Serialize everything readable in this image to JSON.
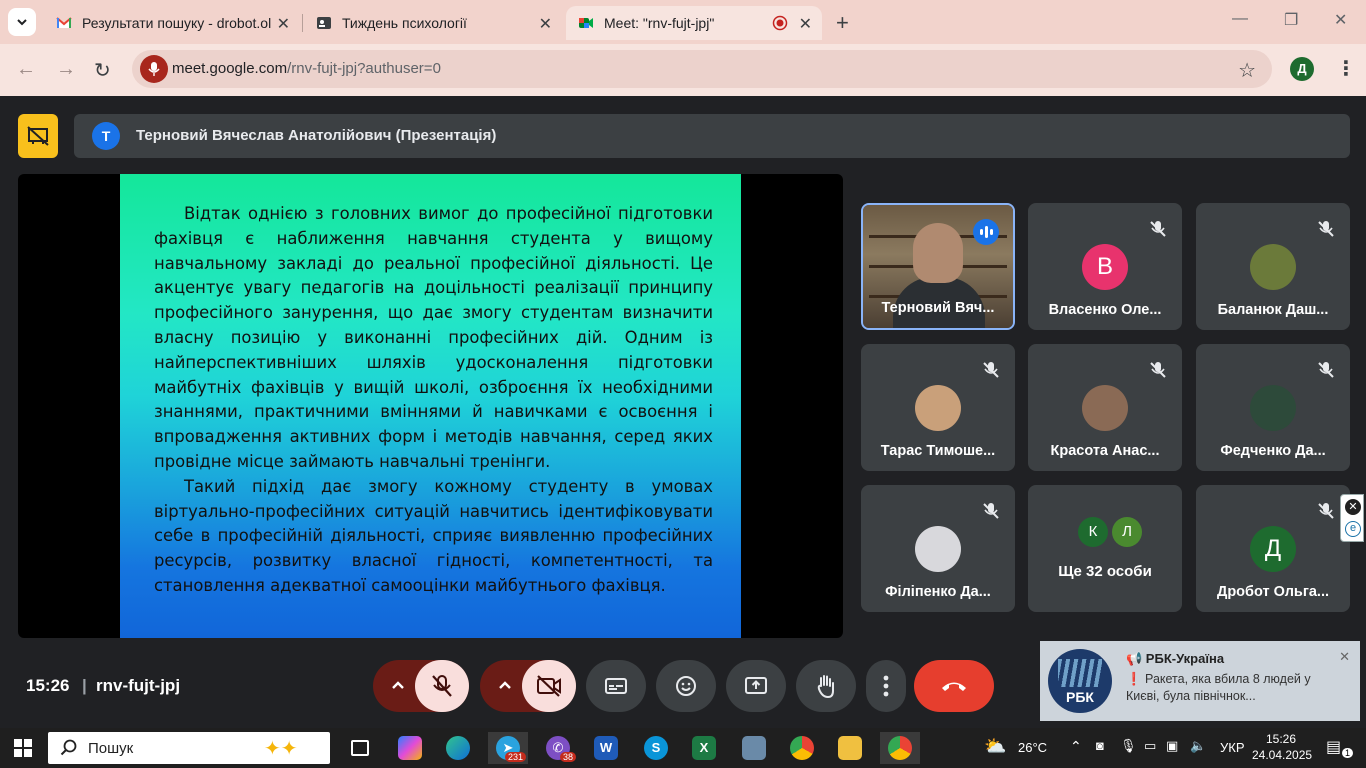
{
  "browser": {
    "tabs": [
      {
        "title": "Результати пошуку - drobot.ol",
        "active": false
      },
      {
        "title": "Тиждень психології",
        "active": false
      },
      {
        "title": "Meet: \"rnv-fujt-jpj\"",
        "active": true
      }
    ],
    "url_host": "meet.google.com",
    "url_path": "/rnv-fujt-jpj?authuser=0",
    "profile_initial": "Д"
  },
  "meet": {
    "presenter_initial": "T",
    "presenter_label": "Терновий Вячеслав Анатолійович (Презентація)",
    "slide_paragraphs": [
      "Відтак однією з головних вимог до професійної підготовки фахівця є наближення навчання студента у вищому навчальному закладі до реальної професійної діяльності. Це акцентує увагу педагогів на доцільності реалізації принципу професійного занурення, що дає змогу студентам визначити власну позицію у виконанні професійних дій. Одним із найперспективніших шляхів удосконалення підготовки майбутніх фахівців у вищій школі, озброєння їх необхідними знаннями, практичними вміннями й навичками є освоєння і впровадження активних форм і методів навчання, серед яких провідне місце займають навчальні тренінги.",
      "Такий підхід дає змогу кожному студенту в умовах віртуально-професійних ситуацій навчитись ідентифіковувати себе в професійній діяльності, сприяє виявленню професійних ресурсів, розвитку власної гідності, компетентності, та становлення адекватної самооцінки майбутнього фахівця."
    ],
    "participants": [
      {
        "name": "Терновий Вяч...",
        "type": "video"
      },
      {
        "name": "Власенко Оле...",
        "initial": "В",
        "color": "#e8336d"
      },
      {
        "name": "Баланюк Даш...",
        "type": "photo",
        "color": "#6b7a3a"
      },
      {
        "name": "Тарас Тимоше...",
        "type": "photo",
        "color": "#c9a07a"
      },
      {
        "name": "Красота Анас...",
        "type": "photo",
        "color": "#8a6a55"
      },
      {
        "name": "Федченко Да...",
        "type": "photo",
        "color": "#2d4a3a"
      },
      {
        "name": "Філіпенко Да...",
        "type": "photo",
        "color": "#d8d8dc"
      },
      {
        "name": "Дробот Ольга...",
        "initial": "Д",
        "color": "#1e6b2f"
      }
    ],
    "more": {
      "initials": [
        "К",
        "Л"
      ],
      "label": "Ще 32 особи"
    },
    "time": "15:26",
    "meeting_code": "rnv-fujt-jpj"
  },
  "notification": {
    "source": "📢 РБК-Україна",
    "logo_text": "РБК",
    "body": "❗ Ракета, яка вбила 8 людей у Києві, була північнок..."
  },
  "taskbar": {
    "search_label": "Пошук",
    "telegram_badge": "231",
    "viber_badge": "38",
    "temperature": "26°C",
    "language": "УКР",
    "clock_time": "15:26",
    "clock_date": "24.04.2025",
    "notif_count": "1"
  },
  "colors": {
    "tabbar": "#f2d3cc",
    "meet_bg": "#202124",
    "tile": "#3c4043",
    "leave": "#e63e2e",
    "mic_off": "#f9dedc"
  }
}
